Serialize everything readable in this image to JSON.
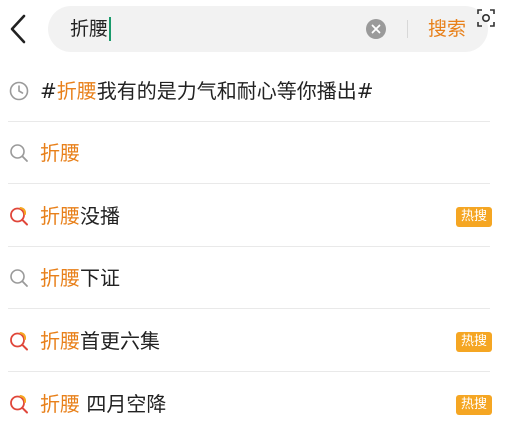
{
  "search": {
    "query": "折腰",
    "submit_label": "搜索"
  },
  "suggestions": [
    {
      "prefix": "#",
      "highlight": "折腰",
      "rest": "我有的是力气和耐心等你播出#",
      "icon": "history-clock-icon",
      "badge": ""
    },
    {
      "prefix": "",
      "highlight": "折腰",
      "rest": "",
      "icon": "search-icon",
      "badge": ""
    },
    {
      "prefix": "",
      "highlight": "折腰",
      "rest": "没播",
      "icon": "hot-search-icon",
      "badge": "热搜"
    },
    {
      "prefix": "",
      "highlight": "折腰",
      "rest": "下证",
      "icon": "search-icon",
      "badge": ""
    },
    {
      "prefix": "",
      "highlight": "折腰",
      "rest": "首更六集",
      "icon": "hot-search-icon",
      "badge": "热搜"
    },
    {
      "prefix": "",
      "highlight": "折腰",
      "rest": " 四月空降",
      "icon": "hot-search-icon",
      "badge": "热搜"
    }
  ],
  "colors": {
    "accent": "#e8801a",
    "badge": "#f5a623",
    "hot_icon_red": "#e0463a"
  }
}
